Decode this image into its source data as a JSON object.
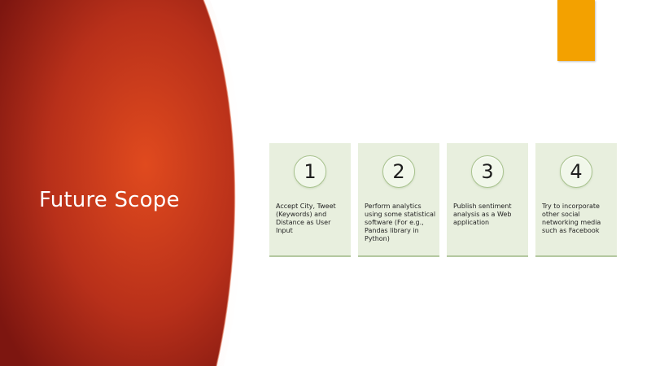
{
  "slide": {
    "title": "Future Scope",
    "accent_colors": {
      "red_panel": "#b83214",
      "orange_tab": "#f3a100",
      "card_fill": "#e8efde",
      "card_border": "#b4c8a0"
    },
    "cards": [
      {
        "number": "1",
        "text": "Accept City, Tweet (Keywords) and  Distance as User Input"
      },
      {
        "number": "2",
        "text": "Perform analytics using some statistical software (For e.g., Pandas library in Python)"
      },
      {
        "number": "3",
        "text": "Publish sentiment analysis as a Web application"
      },
      {
        "number": "4",
        "text": "Try to incorporate other social networking media such as Facebook"
      }
    ]
  }
}
